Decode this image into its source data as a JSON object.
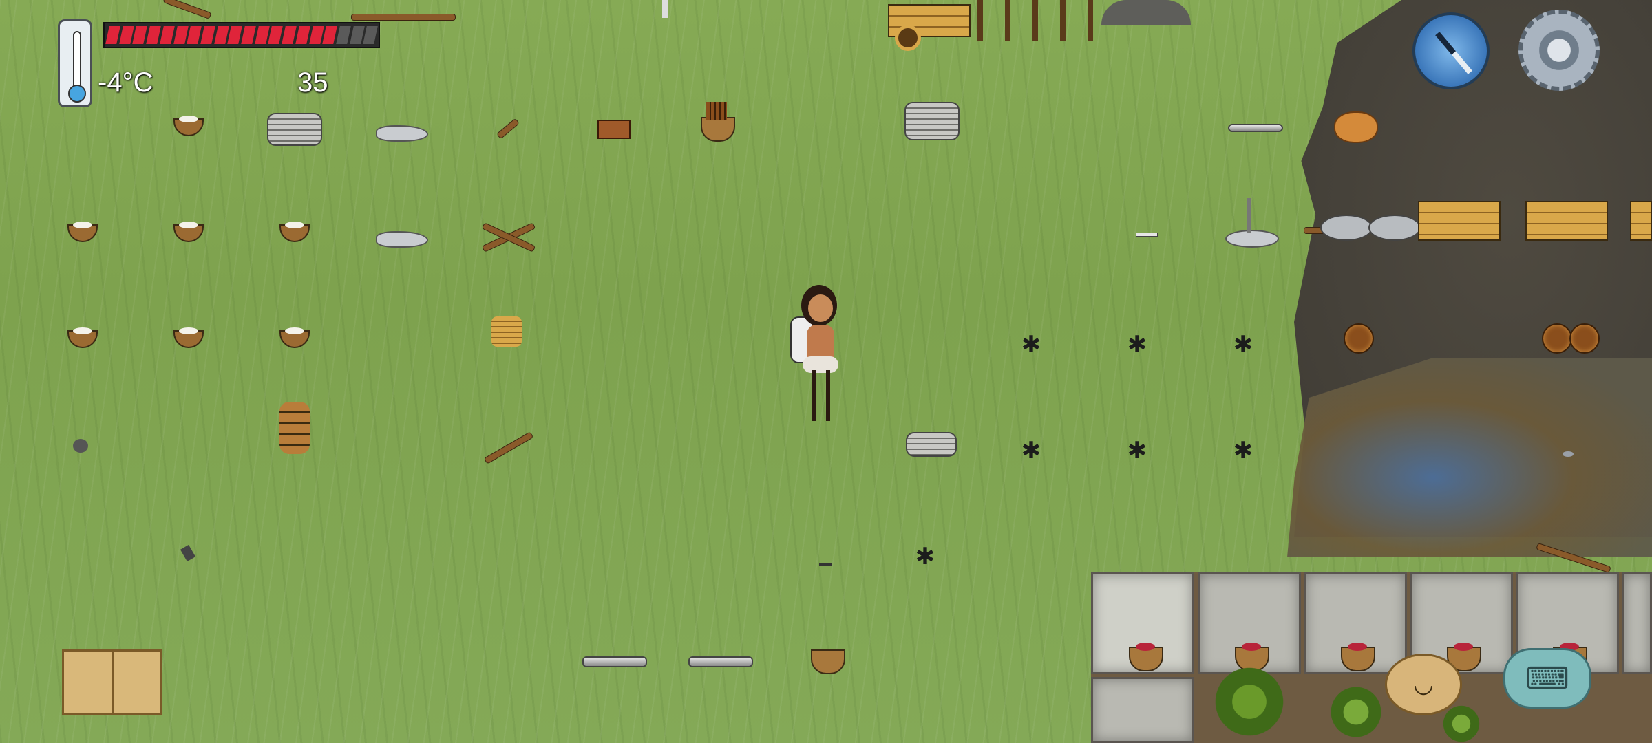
{
  "hud": {
    "temperature": "-4°C",
    "item_count": "35",
    "food_pips_total": 20,
    "food_pips_filled": 17,
    "colors": {
      "food": "#e0243a",
      "thermo": "#47a5e0"
    }
  },
  "icons": {
    "thermometer": "thermometer-icon",
    "compass": "compass-icon",
    "settings": "gear-icon",
    "tech_book": "book-icon",
    "emote": "emote-face-icon",
    "keyboard": "keyboard-icon"
  },
  "emote_face": "◡",
  "keyboard_glyph": "⌨"
}
